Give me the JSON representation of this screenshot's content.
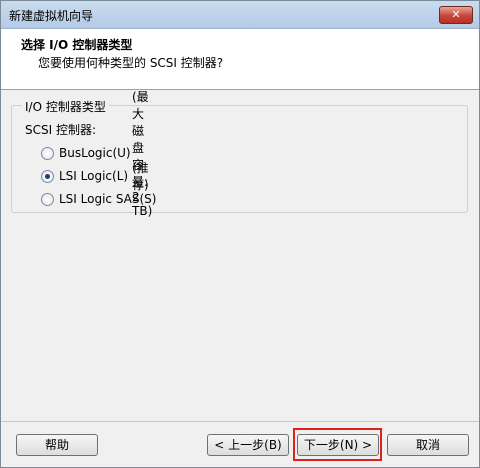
{
  "window": {
    "title": "新建虚拟机向导",
    "close_label": "✕"
  },
  "header": {
    "title": "选择 I/O 控制器类型",
    "subtitle": "您要使用何种类型的 SCSI 控制器?"
  },
  "group": {
    "legend": "I/O 控制器类型",
    "sub_label": "SCSI 控制器:",
    "options": [
      {
        "label": "BusLogic(U)",
        "note": "(最大磁盘容量: 2 TB)",
        "checked": false
      },
      {
        "label": "LSI Logic(L)",
        "note": "(推荐)",
        "checked": true
      },
      {
        "label": "LSI Logic SAS(S)",
        "note": "",
        "checked": false
      }
    ]
  },
  "buttons": {
    "help": "帮助",
    "back": "< 上一步(B)",
    "next": "下一步(N) >",
    "cancel": "取消"
  },
  "colors": {
    "highlight": "#e0201b"
  }
}
